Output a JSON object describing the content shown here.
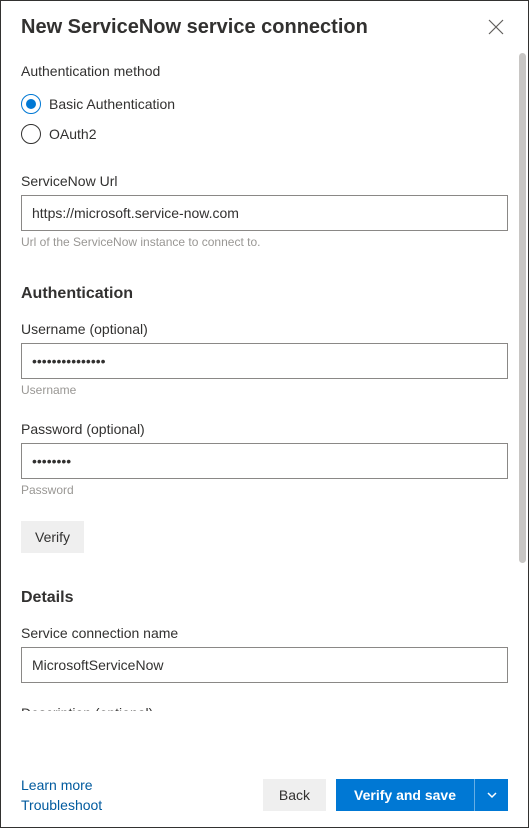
{
  "header": {
    "title": "New ServiceNow service connection"
  },
  "auth_method": {
    "legend": "Authentication method",
    "options": {
      "basic": "Basic Authentication",
      "oauth2": "OAuth2"
    },
    "selected": "basic"
  },
  "url_field": {
    "label": "ServiceNow Url",
    "value": "https://microsoft.service-now.com",
    "help": "Url of the ServiceNow instance to connect to."
  },
  "authentication": {
    "heading": "Authentication",
    "username": {
      "label": "Username (optional)",
      "value": "•••••••••••••••",
      "help": "Username"
    },
    "password": {
      "label": "Password (optional)",
      "value": "••••••••",
      "help": "Password"
    },
    "verify_label": "Verify"
  },
  "details": {
    "heading": "Details",
    "name": {
      "label": "Service connection name",
      "value": "MicrosoftServiceNow"
    }
  },
  "footer": {
    "learn_more": "Learn more",
    "troubleshoot": "Troubleshoot",
    "back": "Back",
    "verify_save": "Verify and save"
  }
}
